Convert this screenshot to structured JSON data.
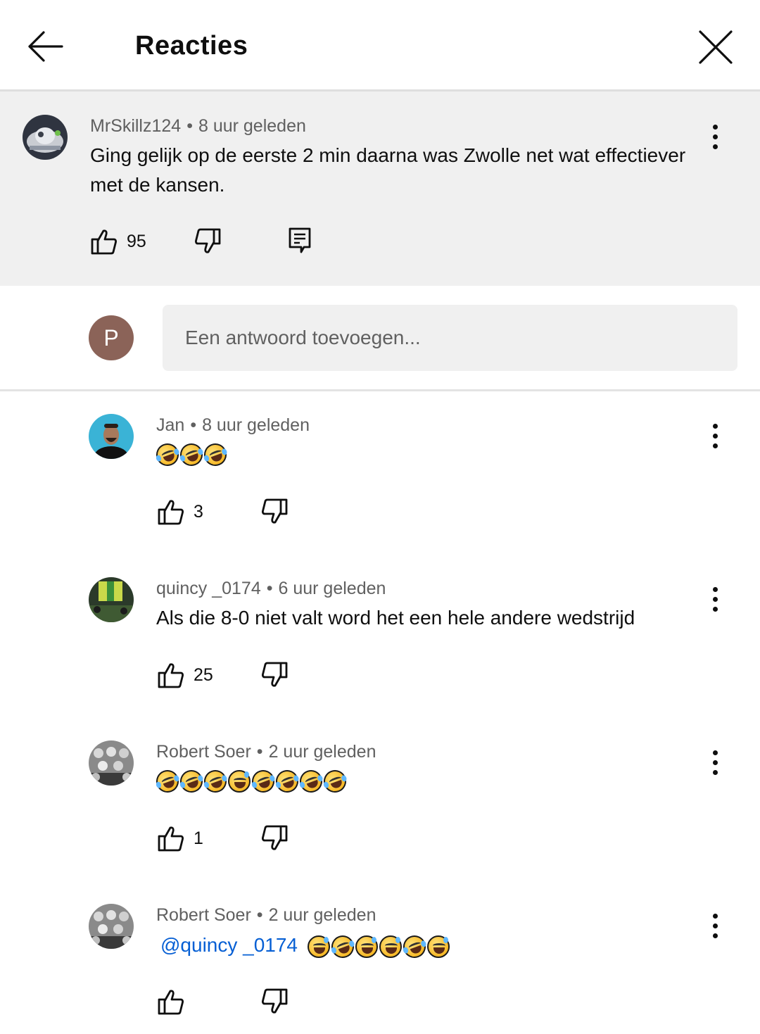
{
  "header": {
    "title": "Reacties",
    "back_icon": "arrow-left-icon",
    "close_icon": "close-icon"
  },
  "parent_comment": {
    "author": "MrSkillz124",
    "time": "8 uur geleden",
    "text": "Ging gelijk op de eerste 2 min daarna was Zwolle net wat effectiever met de kansen.",
    "likes": "95"
  },
  "reply_box": {
    "avatar_letter": "P",
    "avatar_color": "#8b6358",
    "placeholder": "Een antwoord toevoegen..."
  },
  "replies": [
    {
      "author": "Jan",
      "time": "8 uur geleden",
      "likes": "3"
    },
    {
      "author": "quincy _0174",
      "time": "6 uur geleden",
      "text": "Als die 8-0 niet valt word het een hele andere wedstrijd",
      "likes": "25"
    },
    {
      "author": "Robert Soer",
      "time": "2 uur geleden",
      "likes": "1"
    },
    {
      "author": "Robert Soer",
      "time": "2 uur geleden",
      "mention": "@quincy _0174",
      "likes": ""
    }
  ],
  "colors": {
    "mention": "#065fd4",
    "meta_gray": "#606060",
    "parent_bg": "#f0f0f0"
  }
}
